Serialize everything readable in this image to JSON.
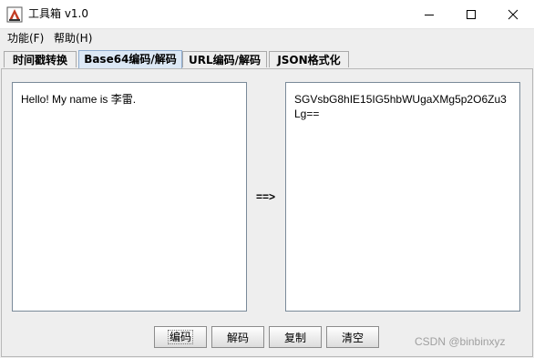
{
  "window": {
    "title": "工具箱 v1.0",
    "app_icon": "toolbox-icon",
    "controls": [
      "minimize-icon",
      "maximize-icon",
      "close-icon"
    ]
  },
  "menu": [
    {
      "label": "功能(F)"
    },
    {
      "label": "帮助(H)"
    }
  ],
  "tabs": [
    {
      "label": "时间戳转换",
      "active": false
    },
    {
      "label": "Base64编码/解码",
      "active": true
    },
    {
      "label": "URL编码/解码",
      "active": false
    },
    {
      "label": "JSON格式化",
      "active": false
    }
  ],
  "panel": {
    "input_text": "Hello! My name is 李雷.",
    "output_text": "SGVsbG8hIE15IG5hbWUgaXMg5p2O6Zu3Lg==",
    "arrow": "==>"
  },
  "buttons": [
    {
      "label": "编码"
    },
    {
      "label": "解码"
    },
    {
      "label": "复制"
    },
    {
      "label": "清空"
    }
  ],
  "watermark": "CSDN @binbinxyz",
  "colors": {
    "active_tab": "#dce8f5",
    "window_bg": "#eeeeee"
  }
}
